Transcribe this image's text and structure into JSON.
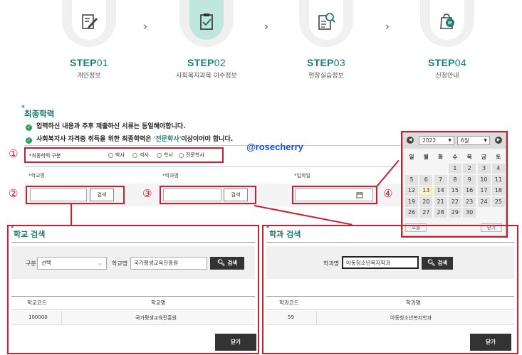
{
  "steps": [
    {
      "prefix": "STEP",
      "num": "01",
      "sub": "개인정보",
      "icon": "pencil-note-icon",
      "active": false
    },
    {
      "prefix": "STEP",
      "num": "02",
      "sub": "사회복지과목 이수정보",
      "icon": "clipboard-check-icon",
      "active": true
    },
    {
      "prefix": "STEP",
      "num": "03",
      "sub": "현장실습정보",
      "icon": "search-document-icon",
      "active": false
    },
    {
      "prefix": "STEP",
      "num": "04",
      "sub": "신청안내",
      "icon": "shopping-bag-chat-icon",
      "active": false
    }
  ],
  "arrow_glyph": "›",
  "section": {
    "title": "최종학력",
    "notice1": "입력하신 내용과 추후 제출하신 서류는 동일해야합니다.",
    "notice2_pre": "사회복지사 자격증 취득을 위한 최종학력은 ",
    "notice2_hl": "'전문학사'",
    "notice2_post": "이상이어야 합니다."
  },
  "annotations": [
    "①",
    "②",
    "③",
    "④"
  ],
  "watermark": "@rosecherry",
  "degree": {
    "label": "*최종학력 구분",
    "options": [
      "박사",
      "석사",
      "학사",
      "전문학사"
    ]
  },
  "fields": {
    "school_label": "*학교명",
    "dept_label": "*학과명",
    "admission_label": "*입학일",
    "search_btn": "검색"
  },
  "calendar": {
    "prev": "◀",
    "next": "▶",
    "year": "2022",
    "month": "6월",
    "weekdays": [
      "일",
      "월",
      "화",
      "수",
      "목",
      "금",
      "토"
    ],
    "rows": [
      [
        "",
        "",
        "",
        "1",
        "2",
        "3",
        "4"
      ],
      [
        "5",
        "6",
        "7",
        "8",
        "9",
        "10",
        "11"
      ],
      [
        "12",
        "13",
        "14",
        "15",
        "16",
        "17",
        "18"
      ],
      [
        "19",
        "20",
        "21",
        "22",
        "23",
        "24",
        "25"
      ],
      [
        "26",
        "27",
        "28",
        "29",
        "30",
        "",
        ""
      ]
    ],
    "today_btn": "오늘",
    "close_btn": "닫기"
  },
  "school_panel": {
    "title": "학교 검색",
    "type_label": "구분",
    "type_value": "선택",
    "name_label": "학교명",
    "name_value": "국가평생교육진흥원",
    "search_btn": "검색",
    "headers": [
      "학교코드",
      "학교명"
    ],
    "row": [
      "100000",
      "국가평생교육진흥원"
    ],
    "close_btn": "닫기"
  },
  "dept_panel": {
    "title": "학과 검색",
    "name_label": "학과명",
    "name_value": "아동청소년복지학과",
    "search_btn": "검색",
    "headers": [
      "학과코드",
      "학과명"
    ],
    "row": [
      "59",
      "아동청소년복지학과"
    ],
    "close_btn": "닫기"
  },
  "colors": {
    "accent": "#1d7c6f",
    "annotation": "#c8202e",
    "watermark": "#1a4fd6"
  }
}
